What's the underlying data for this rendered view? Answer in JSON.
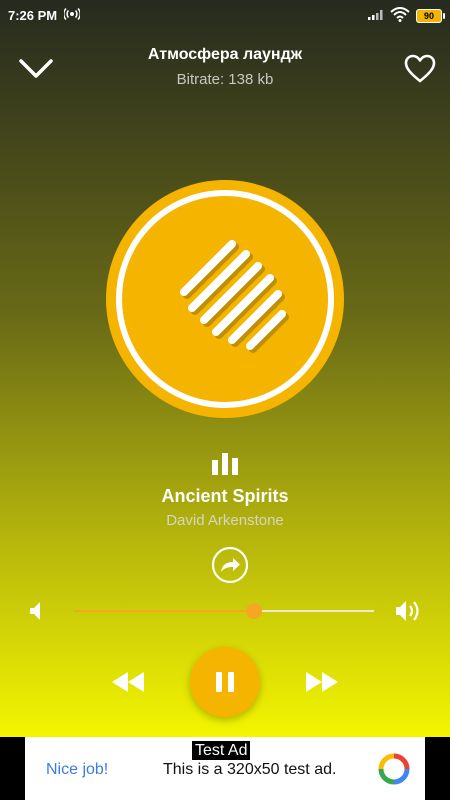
{
  "status_bar": {
    "time": "7:26 PM",
    "battery": "90"
  },
  "header": {
    "station_name": "Атмосфера лаундж",
    "bitrate": "Bitrate: 138 kb"
  },
  "track": {
    "title": "Ancient Spirits",
    "artist": "David Arkenstone"
  },
  "volume": {
    "level_fraction": 0.6
  },
  "colors": {
    "accent": "#f5b400",
    "slider_fill": "#f5a623"
  },
  "icons": [
    "radio-broadcast-icon",
    "signal-icon",
    "wifi-icon",
    "chevron-down-icon",
    "heart-icon",
    "equalizer-bars-icon",
    "share-icon",
    "volume-low-icon",
    "volume-high-icon",
    "rewind-icon",
    "pause-icon",
    "fast-forward-icon",
    "ad-logo-icon"
  ],
  "ad": {
    "label": "Test Ad",
    "cta": "Nice job!",
    "text": "This is a 320x50 test ad."
  }
}
